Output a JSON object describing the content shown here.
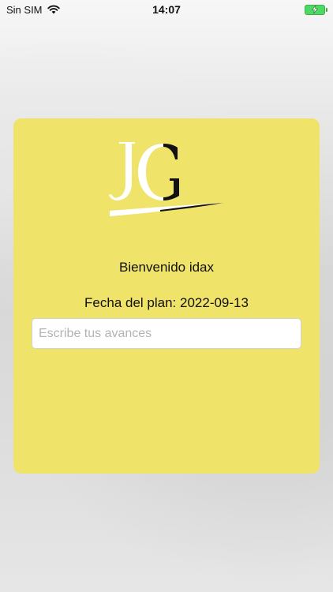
{
  "status_bar": {
    "carrier": "Sin SIM",
    "time": "14:07",
    "wifi_icon": "wifi-icon",
    "battery_icon": "battery-charging-icon"
  },
  "card": {
    "background_color": "#efe36a",
    "logo_text": "JG",
    "welcome_text": "Bienvenido idax",
    "plan_date_text": "Fecha del plan: 2022-09-13",
    "progress_input": {
      "value": "",
      "placeholder": "Escribe tus avances"
    }
  }
}
